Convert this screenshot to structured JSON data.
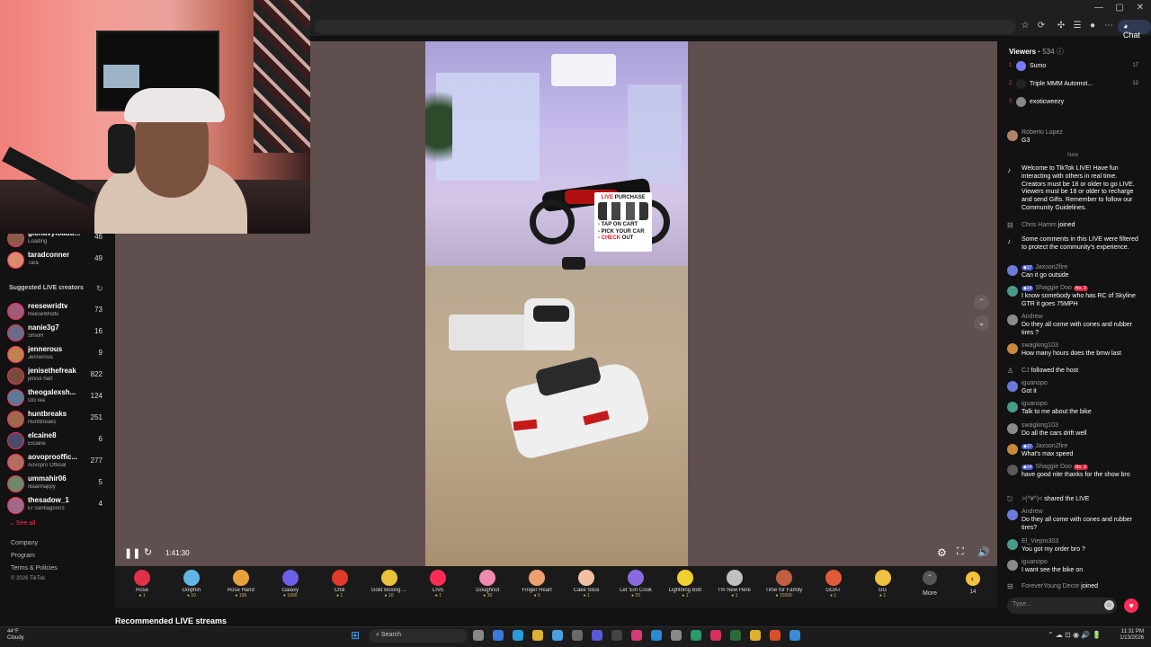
{
  "browser": {
    "chat_label": "Chat"
  },
  "left_panel": {
    "following": [
      {
        "name": "glonavyloadu...",
        "sub": "Loading",
        "count": "46"
      },
      {
        "name": "taradconner",
        "sub": "Tara",
        "count": "49"
      }
    ],
    "suggested_title": "Suggested LIVE creators",
    "suggested": [
      {
        "name": "reesewridtv",
        "sub": "ReeseWridtv",
        "count": "73"
      },
      {
        "name": "nanie3g7",
        "sub": "ShiviH",
        "count": "16"
      },
      {
        "name": "jennerous",
        "sub": "Jennerous",
        "count": "9"
      },
      {
        "name": "jenisethefreak",
        "sub": "jenise hart",
        "count": "822"
      },
      {
        "name": "theogalexsh...",
        "sub": "OGTea",
        "count": "124"
      },
      {
        "name": "huntbreaks",
        "sub": "HuntBreaks",
        "count": "251"
      },
      {
        "name": "elcaine8",
        "sub": "Elcaine",
        "count": "6"
      },
      {
        "name": "aovoprooffic...",
        "sub": "Aovopro Official",
        "count": "277"
      },
      {
        "name": "ummahir06",
        "sub": "Illaanhappy",
        "count": "5"
      },
      {
        "name": "thesadow_1",
        "sub": "El Santiago503",
        "count": "4"
      }
    ],
    "see_all": "See all",
    "footer": [
      "Company",
      "Program",
      "Terms & Policies",
      "© 2026 TikTok"
    ]
  },
  "player": {
    "time": "1:41:30",
    "overlay": {
      "live": "LIVE",
      "purchase": "PURCHASE",
      "line1": "- TAP ON CART",
      "line2": "- PICK YOUR CAR",
      "line3a": "- ",
      "line3b": "CHECK",
      "line3c": " OUT"
    }
  },
  "gifts": [
    {
      "name": "Rose",
      "price": "1",
      "color": "#e0304a"
    },
    {
      "name": "Dolphin",
      "price": "10",
      "color": "#5fb6e6"
    },
    {
      "name": "Rose Hand",
      "price": "199",
      "color": "#e8a23a"
    },
    {
      "name": "Galaxy",
      "price": "1000",
      "color": "#6a5fe6"
    },
    {
      "name": "Chili",
      "price": "1",
      "color": "#e03a2a"
    },
    {
      "name": "Gold Boxing ...",
      "price": "10",
      "color": "#e8c23a"
    },
    {
      "name": "LIVE",
      "price": "1",
      "color": "#fe2c55"
    },
    {
      "name": "Doughnut",
      "price": "30",
      "color": "#f08ab0"
    },
    {
      "name": "Finger Heart",
      "price": "5",
      "color": "#f0a070"
    },
    {
      "name": "Cake Slice",
      "price": "1",
      "color": "#f0c0a0"
    },
    {
      "name": "Let 'Em Cook",
      "price": "20",
      "color": "#8a6ae0"
    },
    {
      "name": "Lightning Bolt",
      "price": "1",
      "color": "#f0d030"
    },
    {
      "name": "I'm New Here",
      "price": "1",
      "color": "#c0c0c0"
    },
    {
      "name": "Time for Family",
      "price": "15000",
      "color": "#c06040"
    },
    {
      "name": "GOAT",
      "price": "1",
      "color": "#e05a3a"
    },
    {
      "name": "GG",
      "price": "1",
      "color": "#f0c040"
    }
  ],
  "gift_more": "More",
  "coin_count": "14",
  "recommended_title": "Recommended LIVE streams",
  "chat": {
    "viewers_label": "Viewers",
    "viewers_count": "534",
    "top_viewers": [
      {
        "rank": "1",
        "name": "Sumo",
        "count": "17",
        "color": "#7a7aff"
      },
      {
        "rank": "2",
        "name": "Triple MMM Automot...",
        "count": "12",
        "color": "#222"
      },
      {
        "rank": "3",
        "name": "exoticweezy",
        "count": "",
        "color": "#888"
      }
    ],
    "pinned": {
      "user": "Roberto Lopez",
      "text": "G3"
    },
    "new_label": "New",
    "welcome": "Welcome to TikTok LIVE! Have fun interacting with others in real time. Creators must be 18 or older to go LIVE. Viewers must be 18 or older to recharge and send Gifts. Remember to follow our Community Guidelines.",
    "joined_1": {
      "user": "Chris Hamm",
      "action": "joined"
    },
    "filtered": "Some comments in this LIVE were filtered to protect the community's experience.",
    "messages": [
      {
        "user": "Jaxson2fire",
        "level": "17",
        "text": "Can it go outside"
      },
      {
        "user": "Shaggie Doo",
        "level": "14",
        "badge": "No. 3",
        "text": "I know somebody who has RC of Skyline GTR it goes 75MPH"
      },
      {
        "user": "Andrew",
        "text": "Do they all come with cones and rubber tires ?"
      },
      {
        "user": "swagking103",
        "text": "How many hours does the bmw last"
      }
    ],
    "followed": {
      "user": "CJ",
      "action": "followed the host"
    },
    "messages2": [
      {
        "user": "iguanopo",
        "text": "Got it"
      },
      {
        "user": "iguanopo",
        "text": "Talk to me about the bike"
      },
      {
        "user": "swagking103",
        "text": "Do all the cars drift well"
      },
      {
        "user": "Jaxson2fire",
        "level": "17",
        "text": "What's max speed"
      },
      {
        "user": "Shaggie Doo",
        "level": "14",
        "badge": "No. 3",
        "text": "have good nite thanks for the show bro"
      }
    ],
    "shared": {
      "user": ">(^¥^)<",
      "action": "shared the LIVE"
    },
    "messages3": [
      {
        "user": "Andrew",
        "text": "Do they all come with cones and rubber tires?"
      },
      {
        "user": "El_Viejon303",
        "text": "You got my order bro ?"
      },
      {
        "user": "iguanopo",
        "text": "I want see the bike on"
      }
    ],
    "joined_2": {
      "user": "ForeverYoung Decor",
      "action": "joined"
    },
    "input_placeholder": "Type..."
  },
  "taskbar": {
    "temp": "44°F",
    "weather": "Cloudy",
    "search": "Search",
    "time": "11:31 PM",
    "date": "1/13/2026"
  }
}
